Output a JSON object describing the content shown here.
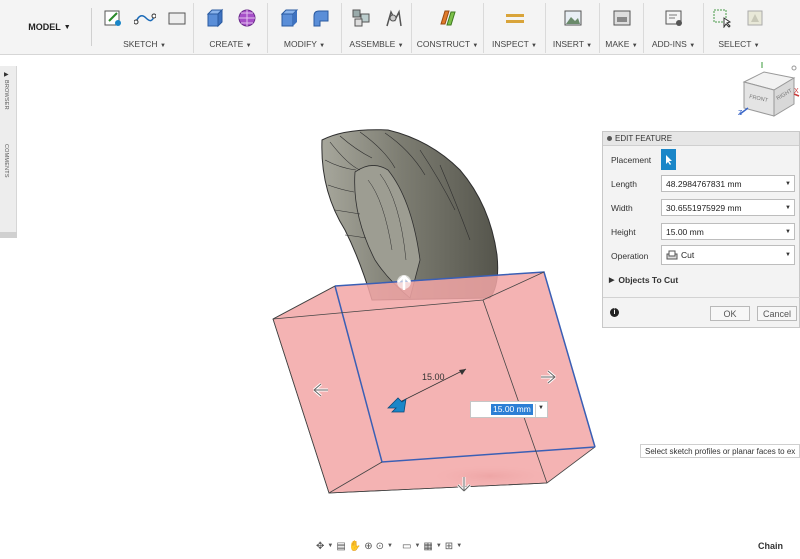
{
  "toolbar": {
    "mode": "MODEL",
    "groups": [
      {
        "label": "SKETCH"
      },
      {
        "label": "CREATE"
      },
      {
        "label": "MODIFY"
      },
      {
        "label": "ASSEMBLE"
      },
      {
        "label": "CONSTRUCT"
      },
      {
        "label": "INSPECT"
      },
      {
        "label": "INSERT"
      },
      {
        "label": "MAKE"
      },
      {
        "label": "ADD-INS"
      },
      {
        "label": "SELECT"
      }
    ]
  },
  "left_panel": {
    "browser": "BROWSER",
    "comments": "COMMENTS"
  },
  "viewcube": {
    "front": "FRONT",
    "right": "RIGHT",
    "z": "Z",
    "x": "X"
  },
  "edit_feature": {
    "title": "EDIT FEATURE",
    "placement_label": "Placement",
    "length_label": "Length",
    "length_value": "48.2984767831 mm",
    "width_label": "Width",
    "width_value": "30.6551975929 mm",
    "height_label": "Height",
    "height_value": "15.00 mm",
    "operation_label": "Operation",
    "operation_value": "Cut",
    "objects_to_cut": "Objects To Cut",
    "ok": "OK",
    "cancel": "Cancel"
  },
  "viewport": {
    "dimension_label": "15.00",
    "dimension_input": "15.00 mm"
  },
  "status": {
    "tip": "Select sketch profiles or planar faces to ex",
    "chain": "Chain"
  },
  "colors": {
    "box_fill": "#f2a6a6",
    "box_edge": "#3a5fb5",
    "body_gray": "#8a8a80",
    "accent_blue": "#1a86c8"
  }
}
